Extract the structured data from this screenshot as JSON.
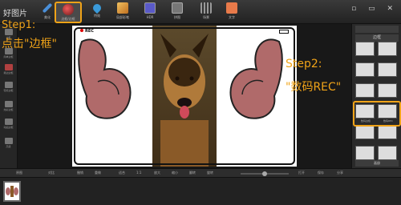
{
  "app": {
    "logo": "好图片"
  },
  "toolbar": {
    "items": [
      {
        "label": "美化",
        "icon": "pen-icon",
        "color": "#4a8fd8"
      },
      {
        "label": "边框/边框",
        "icon": "frame-brush-icon",
        "color": "#d84a4a",
        "active": true
      },
      {
        "label": "特效",
        "icon": "drop-icon",
        "color": "#3a9ad9"
      },
      {
        "label": "局部彩笔",
        "icon": "brush-icon",
        "color": "#e8b04a"
      },
      {
        "label": "HDR",
        "icon": "hdr-icon",
        "color": "#7a7ad8"
      },
      {
        "label": "拼图",
        "icon": "collage-icon",
        "color": "#8888aa"
      },
      {
        "label": "场景",
        "icon": "film-icon",
        "color": "#aaaaaa"
      },
      {
        "label": "文字",
        "icon": "text-icon",
        "color": "#e87a4a"
      }
    ],
    "window_controls": "▫ ▭ ✕"
  },
  "left_panel": {
    "items": [
      {
        "label": "边框"
      },
      {
        "label": "简单边框"
      },
      {
        "label": "撕边边框"
      },
      {
        "label": "轻松边框"
      },
      {
        "label": "炫彩边框"
      },
      {
        "label": "动画边框"
      },
      {
        "label": "高级"
      }
    ]
  },
  "canvas": {
    "rec_text": "REC"
  },
  "annotations": {
    "step1": "Step1:",
    "step1_text": "点击\"边框\"",
    "step2": "Step2:",
    "step2_text": "\"数码REC\""
  },
  "right_panel": {
    "header_top": "",
    "section": "边框",
    "thumbs": [
      {
        "label": ""
      },
      {
        "label": ""
      },
      {
        "label": ""
      },
      {
        "label": ""
      },
      {
        "label": ""
      },
      {
        "label": ""
      },
      {
        "label": "数码边框"
      },
      {
        "label": "数码REC"
      },
      {
        "label": ""
      },
      {
        "label": ""
      },
      {
        "label": ""
      },
      {
        "label": ""
      }
    ],
    "bottom": "画册"
  },
  "bottom_bar": {
    "items": [
      "原图",
      "对比",
      "撤销",
      "重做",
      "适合",
      "1:1",
      "放大",
      "缩小",
      "翻转",
      "旋转",
      "打开",
      "保存",
      "分享"
    ],
    "zoom_value": 50
  },
  "colors": {
    "accent": "#f0a318"
  }
}
